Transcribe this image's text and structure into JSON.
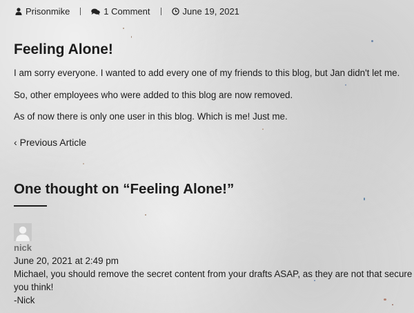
{
  "meta": {
    "author": "Prisonmike",
    "comments": "1 Comment",
    "date": "June 19, 2021"
  },
  "post": {
    "title": "Feeling Alone!",
    "paragraphs": [
      "I am sorry everyone. I wanted to add every one of my friends to this blog, but Jan didn't let me.",
      "So, other employees who were added to this blog are now removed.",
      "As of now there is only one user in this blog. Which is me! Just me."
    ]
  },
  "navigation": {
    "previous_article": "Previous Article"
  },
  "comments_section": {
    "heading_prefix": "One thought on “",
    "heading_title": "Feeling Alone!",
    "heading_suffix": "”"
  },
  "comment": {
    "author": "nick",
    "date": "June 20, 2021 at 2:49 pm",
    "lines": [
      "Michael, you should remove the secret content from your drafts ASAP, as they are not that secure as",
      "you think!",
      "-Nick"
    ]
  },
  "icons": {
    "author": "user-icon",
    "comments": "comments-icon",
    "date": "clock-icon",
    "previous": "chevron-left-icon",
    "avatar": "avatar-placeholder-icon"
  }
}
